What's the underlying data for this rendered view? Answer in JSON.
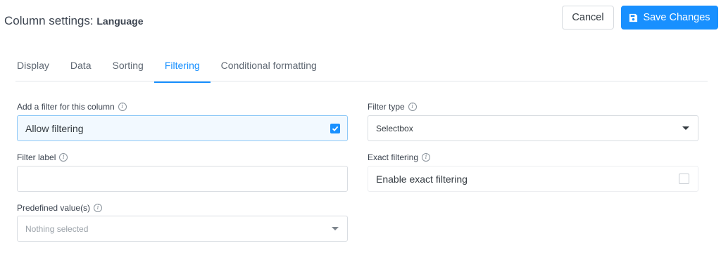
{
  "header": {
    "title_prefix": "Column settings:",
    "column_name": "Language",
    "cancel_label": "Cancel",
    "save_label": "Save Changes"
  },
  "tabs": [
    {
      "label": "Display",
      "active": false
    },
    {
      "label": "Data",
      "active": false
    },
    {
      "label": "Sorting",
      "active": false
    },
    {
      "label": "Filtering",
      "active": true
    },
    {
      "label": "Conditional formatting",
      "active": false
    }
  ],
  "form": {
    "add_filter": {
      "label": "Add a filter for this column",
      "value": "Allow filtering",
      "checked": true
    },
    "filter_type": {
      "label": "Filter type",
      "value": "Selectbox"
    },
    "filter_label": {
      "label": "Filter label",
      "value": ""
    },
    "exact_filtering": {
      "label": "Exact filtering",
      "value": "Enable exact filtering",
      "checked": false
    },
    "predefined_values": {
      "label": "Predefined value(s)",
      "placeholder": "Nothing selected"
    }
  },
  "colors": {
    "accent": "#1890ff",
    "highlight_bg": "#f2f9ff",
    "border": "#d9dde2"
  }
}
